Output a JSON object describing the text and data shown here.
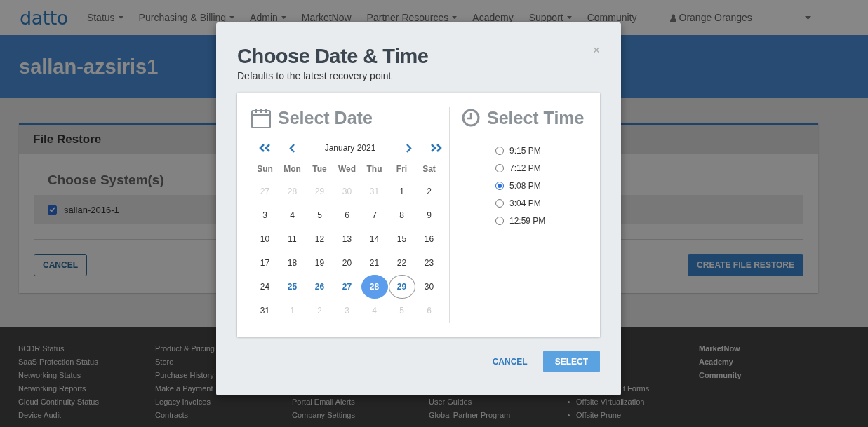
{
  "nav": {
    "logo": "datto",
    "items": [
      {
        "label": "Status",
        "dropdown": true
      },
      {
        "label": "Purchasing & Billing",
        "dropdown": true
      },
      {
        "label": "Admin",
        "dropdown": true
      },
      {
        "label": "MarketNow",
        "dropdown": false
      },
      {
        "label": "Partner Resources",
        "dropdown": true
      },
      {
        "label": "Academy",
        "dropdown": false
      },
      {
        "label": "Support",
        "dropdown": true
      },
      {
        "label": "Community",
        "dropdown": false
      }
    ],
    "user": "Orange Oranges"
  },
  "page_title": "sallan-azsiris1",
  "card": {
    "title": "File Restore",
    "section_title": "Choose System(s)",
    "systems": [
      {
        "label": "sallan-2016-1",
        "checked": true
      }
    ],
    "cancel": "CANCEL",
    "create": "CREATE FILE RESTORE"
  },
  "footer": {
    "columns": [
      {
        "items": [
          {
            "text": "BCDR Status",
            "kind": "plain"
          },
          {
            "text": "SaaS Protection Status",
            "kind": "plain"
          },
          {
            "text": "Networking Status",
            "kind": "plain"
          },
          {
            "text": "Networking Reports",
            "kind": "plain"
          },
          {
            "text": "Cloud Continuity Status",
            "kind": "plain"
          },
          {
            "text": "Device Audit",
            "kind": "plain"
          }
        ]
      },
      {
        "items": [
          {
            "text": "Product & Pricing",
            "kind": "plain"
          },
          {
            "text": "Store",
            "kind": "plain"
          },
          {
            "text": "Purchase History",
            "kind": "plain"
          },
          {
            "text": "Make a Payment",
            "kind": "plain"
          },
          {
            "text": "Legacy Invoices",
            "kind": "plain"
          },
          {
            "text": "Contracts",
            "kind": "plain"
          }
        ]
      },
      {
        "items": [
          {
            "text": "Portal Email Alerts",
            "kind": "plain"
          },
          {
            "text": "Company Settings",
            "kind": "plain"
          }
        ]
      },
      {
        "items": [
          {
            "text": "User Guides",
            "kind": "plain"
          },
          {
            "text": "Global Partner Program",
            "kind": "plain"
          }
        ]
      },
      {
        "items": [
          {
            "text": "t Forms",
            "kind": "cut"
          },
          {
            "text": "Offsite Virtualization",
            "kind": "bullet"
          },
          {
            "text": "Offsite Prune",
            "kind": "bullet"
          }
        ]
      },
      {
        "items": [
          {
            "text": "MarketNow",
            "kind": "bold"
          },
          {
            "text": "Academy",
            "kind": "bold"
          },
          {
            "text": "Community",
            "kind": "bold"
          }
        ]
      }
    ]
  },
  "modal": {
    "title": "Choose Date & Time",
    "subtitle": "Defaults to the latest recovery point",
    "close": "×",
    "date": {
      "heading": "Select Date",
      "month": "January 2021",
      "weekdays": [
        "Sun",
        "Mon",
        "Tue",
        "Wed",
        "Thu",
        "Fri",
        "Sat"
      ],
      "days": [
        {
          "label": "27",
          "kind": "other",
          "selected": false
        },
        {
          "label": "28",
          "kind": "other",
          "selected": false
        },
        {
          "label": "29",
          "kind": "other",
          "selected": false
        },
        {
          "label": "30",
          "kind": "other",
          "selected": false
        },
        {
          "label": "31",
          "kind": "other",
          "selected": false
        },
        {
          "label": "1",
          "kind": "day",
          "selected": false
        },
        {
          "label": "2",
          "kind": "day",
          "selected": false
        },
        {
          "label": "3",
          "kind": "day",
          "selected": false
        },
        {
          "label": "4",
          "kind": "day",
          "selected": false
        },
        {
          "label": "5",
          "kind": "day",
          "selected": false
        },
        {
          "label": "6",
          "kind": "day",
          "selected": false
        },
        {
          "label": "7",
          "kind": "day",
          "selected": false
        },
        {
          "label": "8",
          "kind": "day",
          "selected": false
        },
        {
          "label": "9",
          "kind": "day",
          "selected": false
        },
        {
          "label": "10",
          "kind": "day",
          "selected": false
        },
        {
          "label": "11",
          "kind": "day",
          "selected": false
        },
        {
          "label": "12",
          "kind": "day",
          "selected": false
        },
        {
          "label": "13",
          "kind": "day",
          "selected": false
        },
        {
          "label": "14",
          "kind": "day",
          "selected": false
        },
        {
          "label": "15",
          "kind": "day",
          "selected": false
        },
        {
          "label": "16",
          "kind": "day",
          "selected": false
        },
        {
          "label": "17",
          "kind": "day",
          "selected": false
        },
        {
          "label": "18",
          "kind": "day",
          "selected": false
        },
        {
          "label": "19",
          "kind": "day",
          "selected": false
        },
        {
          "label": "20",
          "kind": "day",
          "selected": false
        },
        {
          "label": "21",
          "kind": "day",
          "selected": false
        },
        {
          "label": "22",
          "kind": "day",
          "selected": false
        },
        {
          "label": "23",
          "kind": "day",
          "selected": false
        },
        {
          "label": "24",
          "kind": "day",
          "selected": false
        },
        {
          "label": "25",
          "kind": "available",
          "selected": false
        },
        {
          "label": "26",
          "kind": "available",
          "selected": false
        },
        {
          "label": "27",
          "kind": "available",
          "selected": false
        },
        {
          "label": "28",
          "kind": "available",
          "selected": true
        },
        {
          "label": "29",
          "kind": "today",
          "selected": false
        },
        {
          "label": "30",
          "kind": "day",
          "selected": false
        },
        {
          "label": "31",
          "kind": "day",
          "selected": false
        },
        {
          "label": "1",
          "kind": "other",
          "selected": false
        },
        {
          "label": "2",
          "kind": "other",
          "selected": false
        },
        {
          "label": "3",
          "kind": "other",
          "selected": false
        },
        {
          "label": "4",
          "kind": "other",
          "selected": false
        },
        {
          "label": "5",
          "kind": "other",
          "selected": false
        },
        {
          "label": "6",
          "kind": "other",
          "selected": false
        }
      ]
    },
    "time": {
      "heading": "Select Time",
      "options": [
        {
          "label": "9:15 PM",
          "selected": false
        },
        {
          "label": "7:12 PM",
          "selected": false
        },
        {
          "label": "5:08 PM",
          "selected": true
        },
        {
          "label": "3:04 PM",
          "selected": false
        },
        {
          "label": "12:59 PM",
          "selected": false
        }
      ]
    },
    "cancel": "CANCEL",
    "select": "SELECT"
  }
}
